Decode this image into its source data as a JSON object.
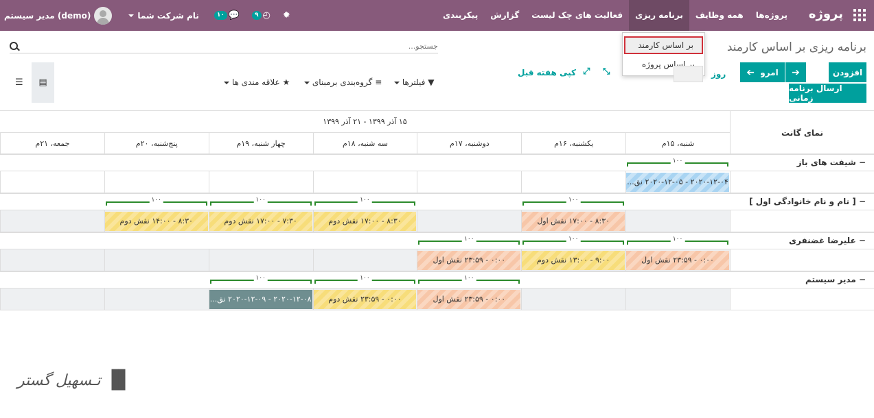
{
  "topbar": {
    "brand": "پروژه",
    "menu": [
      "پروژه‌ها",
      "همه وظایف",
      "برنامه ریزی",
      "فعالیت های چک لیست",
      "گزارش",
      "پیکربندی"
    ],
    "user": "مدیر سیستم (demo)",
    "company": "نام شرکت شما",
    "chat_count": "۱۰",
    "activity_count": "۹"
  },
  "dropdown": {
    "items": [
      "بر اساس کارمند",
      "بر اساس پروژه"
    ]
  },
  "page_title": "برنامه ریزی بر اساس کارمند",
  "search_placeholder": "جستجو...",
  "buttons": {
    "add": "افزودن",
    "send_schedule": "ارسال برنامه زمانی",
    "today": "امروز",
    "day": "روز",
    "copy_prev_week": "کپی هفته قبل"
  },
  "filters": {
    "filters": "فیلترها",
    "groupby": "گروه‌بندی برمبنای",
    "favorites": "علاقه مندی ها"
  },
  "gantt": {
    "header_label": "نمای گانت",
    "range": "۱۵ آذر ۱۳۹۹ - ۲۱ آذر ۱۳۹۹",
    "days": [
      "شنبه، ۱۵م",
      "یکشنبه، ۱۶م",
      "دوشنبه، ۱۷م",
      "سه شنبه، ۱۸م",
      "چهار شنبه، ۱۹م",
      "پنج‌شنبه، ۲۰م",
      "جمعه، ۲۱م"
    ],
    "groups": [
      {
        "label": "شیفت های باز",
        "pills": [
          {
            "text": "۲۰۲۰-۱۲-۰۴ - ۲۰۲۰-۱۲-۰۵ نق...",
            "color": "blue",
            "day_start": 0,
            "day_span": 1
          }
        ],
        "bars": [
          {
            "day_start": 0,
            "day_span": 1,
            "pct": "۱۰۰"
          }
        ]
      },
      {
        "label": "[ نام و نام خانوادگی اول ]",
        "pills": [
          {
            "text": "۸:۳۰ - ۱۷:۰۰ نقش اول",
            "color": "orange",
            "day_start": 1,
            "day_span": 1
          },
          {
            "text": "۸:۳۰ - ۱۷:۰۰ نقش دوم",
            "color": "yellow",
            "day_start": 3,
            "day_span": 1
          },
          {
            "text": "۷:۳۰ - ۱۷:۰۰ نقش دوم",
            "color": "yellow",
            "day_start": 4,
            "day_span": 1
          },
          {
            "text": "۸:۳۰ - ۱۴:۰۰ نقش دوم",
            "color": "yellow",
            "day_start": 5,
            "day_span": 1
          }
        ],
        "bars": [
          {
            "day_start": 1,
            "day_span": 1,
            "pct": "۱۰۰"
          },
          {
            "day_start": 3,
            "day_span": 1,
            "pct": "۱۰۰"
          },
          {
            "day_start": 4,
            "day_span": 1,
            "pct": "۱۰۰"
          },
          {
            "day_start": 5,
            "day_span": 1,
            "pct": "۱۰۰"
          }
        ]
      },
      {
        "label": "علیرضا غضنفری",
        "pills": [
          {
            "text": "۰:۰۰ - ۲۳:۵۹ نقش اول",
            "color": "orange",
            "day_start": 0,
            "day_span": 1
          },
          {
            "text": "۹:۰۰ - ۱۳:۰۰ نقش دوم",
            "color": "yellow",
            "day_start": 1,
            "day_span": 1
          },
          {
            "text": "۰:۰۰ - ۲۳:۵۹ نقش اول",
            "color": "orange",
            "day_start": 2,
            "day_span": 1
          }
        ],
        "bars": [
          {
            "day_start": 0,
            "day_span": 1,
            "pct": "۱۰۰"
          },
          {
            "day_start": 1,
            "day_span": 1,
            "pct": "۱۰۰"
          },
          {
            "day_start": 2,
            "day_span": 1,
            "pct": "۱۰۰"
          }
        ]
      },
      {
        "label": "مدیر سیستم",
        "pills": [
          {
            "text": "۰:۰۰ - ۲۳:۵۹ نقش اول",
            "color": "orange",
            "day_start": 2,
            "day_span": 1
          },
          {
            "text": "۰:۰۰ - ۲۳:۵۹ نقش دوم",
            "color": "yellow",
            "day_start": 3,
            "day_span": 1
          },
          {
            "text": "۲۰۲۰-۱۲-۰۸ - ۲۰۲۰-۱۲-۰۹ نق...",
            "color": "gray",
            "day_start": 4,
            "day_span": 1
          }
        ],
        "bars": [
          {
            "day_start": 2,
            "day_span": 1,
            "pct": "۱۰۰"
          },
          {
            "day_start": 3,
            "day_span": 1,
            "pct": "۱۰۰"
          },
          {
            "day_start": 4,
            "day_span": 1,
            "pct": "۱۰۰"
          }
        ]
      }
    ]
  },
  "watermark": "تـسهیل گستر"
}
